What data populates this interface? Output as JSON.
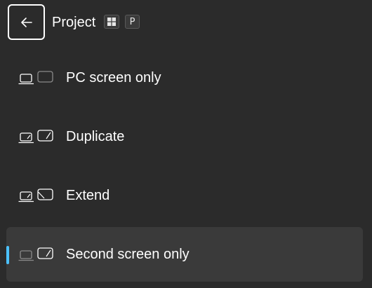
{
  "header": {
    "title": "Project",
    "shortcut_key": "P",
    "back_icon": "arrow-left-icon",
    "windows_key_icon": "windows-logo-icon"
  },
  "options": [
    {
      "label": "PC screen only",
      "icon": "pc-screen-only-icon"
    },
    {
      "label": "Duplicate",
      "icon": "duplicate-icon"
    },
    {
      "label": "Extend",
      "icon": "extend-icon"
    },
    {
      "label": "Second screen only",
      "icon": "second-screen-only-icon",
      "selected": true
    }
  ],
  "colors": {
    "background": "#2b2b2b",
    "selected_background": "#3a3a3a",
    "accent": "#4cc2ff",
    "text": "#ffffff"
  }
}
